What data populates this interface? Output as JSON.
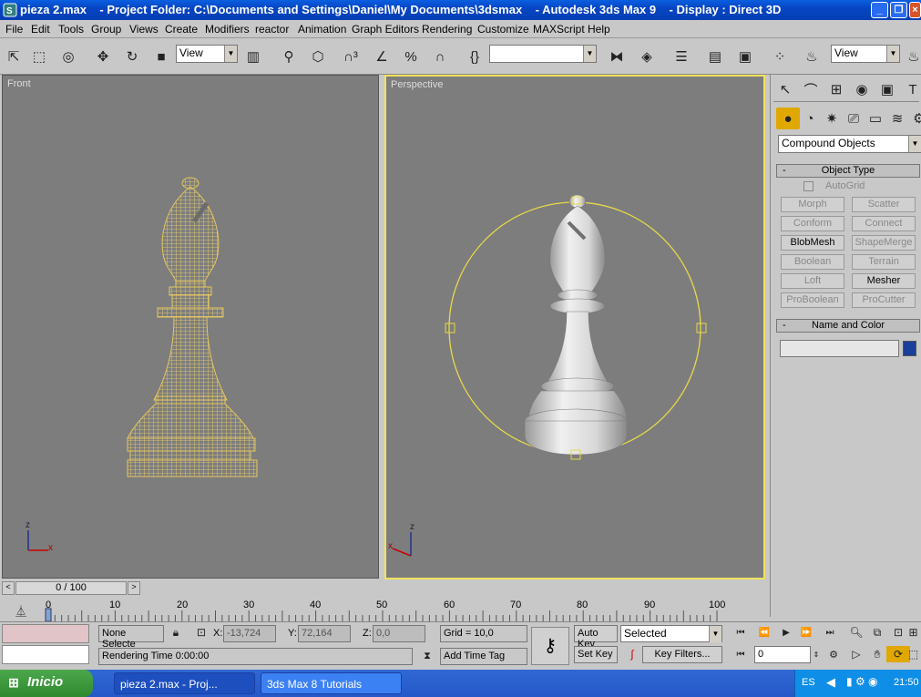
{
  "window": {
    "title": "pieza 2.max    - Project Folder: C:\\Documents and Settings\\Daniel\\My Documents\\3dsmax    - Autodesk 3ds Max 9    - Display : Direct 3D"
  },
  "menu": [
    "File",
    "Edit",
    "Tools",
    "Group",
    "Views",
    "Create",
    "Modifiers",
    "reactor",
    "Animation",
    "Graph Editors",
    "Rendering",
    "Customize",
    "MAXScript",
    "Help"
  ],
  "toolbar": {
    "ref_coord": "View",
    "view_dd": "View",
    "named_sel": ""
  },
  "viewports": {
    "front": "Front",
    "perspective": "Perspective"
  },
  "axes": {
    "z": "z",
    "x": "x"
  },
  "cmd": {
    "category": "Compound Objects",
    "object_type": "Object Type",
    "autogrid": "AutoGrid",
    "buttons": [
      "Morph",
      "Scatter",
      "Conform",
      "Connect",
      "BlobMesh",
      "ShapeMerge",
      "Boolean",
      "Terrain",
      "Loft",
      "Mesher",
      "ProBoolean",
      "ProCutter"
    ],
    "name_color": "Name and Color",
    "object_color": "#1a3f99"
  },
  "time": {
    "slider": "0 / 100",
    "ticks": [
      "0",
      "10",
      "20",
      "30",
      "40",
      "50",
      "60",
      "70",
      "80",
      "90",
      "100"
    ]
  },
  "status": {
    "selection": "None Selecte",
    "x_label": "X:",
    "x_val": "-13,724",
    "y_label": "Y:",
    "y_val": "72,164",
    "z_label": "Z:",
    "z_val": "0,0",
    "grid": "Grid = 10,0",
    "auto_key": "Auto Key",
    "set_key": "Set Key",
    "key_mode": "Selected",
    "key_filters": "Key Filters...",
    "frame": "0",
    "render_time": "Rendering Time  0:00:00",
    "add_time_tag": "Add Time Tag"
  },
  "taskbar": {
    "start": "Inicio",
    "task1": "pieza 2.max     - Proj...",
    "task2": "3ds Max 8 Tutorials",
    "lang": "ES",
    "clock": "21:50"
  }
}
